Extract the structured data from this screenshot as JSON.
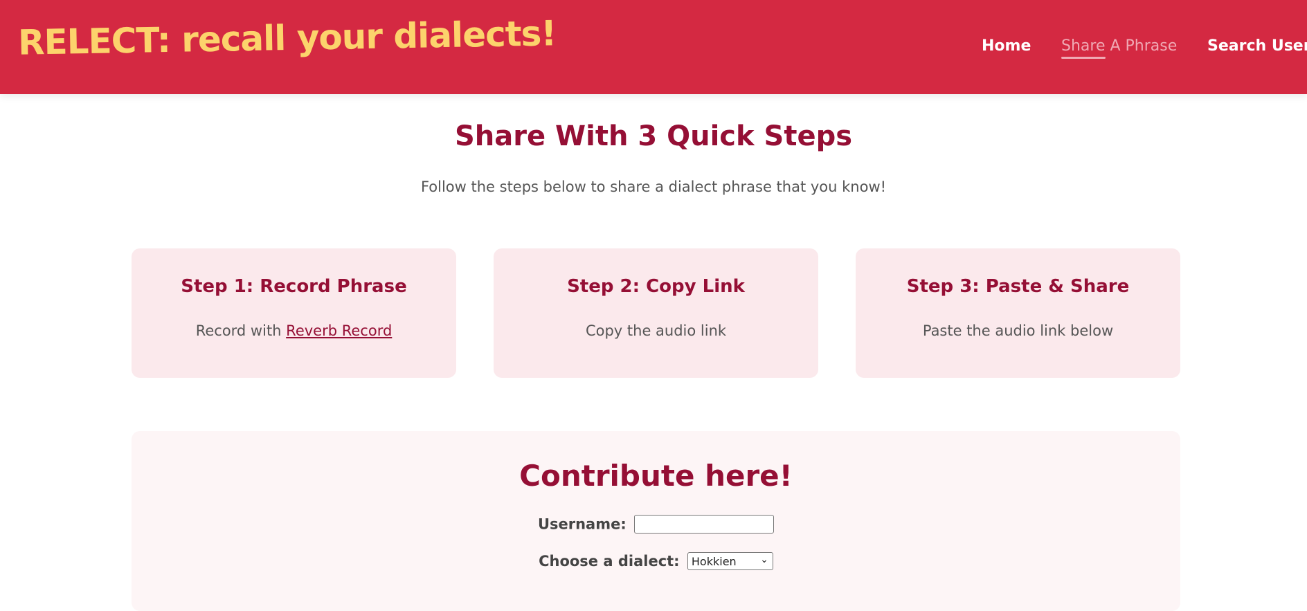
{
  "header": {
    "brand": "RELECT: recall your dialects!",
    "nav": {
      "home": "Home",
      "share": "Share A Phrase",
      "search": "Search User"
    }
  },
  "intro": {
    "title": "Share With 3 Quick Steps",
    "subtitle": "Follow the steps below to share a dialect phrase that you know!"
  },
  "steps": [
    {
      "title": "Step 1: Record Phrase",
      "text_prefix": "Record with ",
      "link": "Reverb Record"
    },
    {
      "title": "Step 2: Copy Link",
      "text": "Copy the audio link"
    },
    {
      "title": "Step 3: Paste & Share",
      "text": "Paste the audio link below"
    }
  ],
  "contribute": {
    "title": "Contribute here!",
    "username_label": "Username:",
    "username_value": "",
    "dialect_label": "Choose a dialect:",
    "dialect_selected": "Hokkien"
  },
  "colors": {
    "header_bg": "#d42942",
    "brand": "#fcd36c",
    "heading": "#950f35",
    "card_bg": "#fbe9ec",
    "panel_bg": "#fdf5f6"
  }
}
